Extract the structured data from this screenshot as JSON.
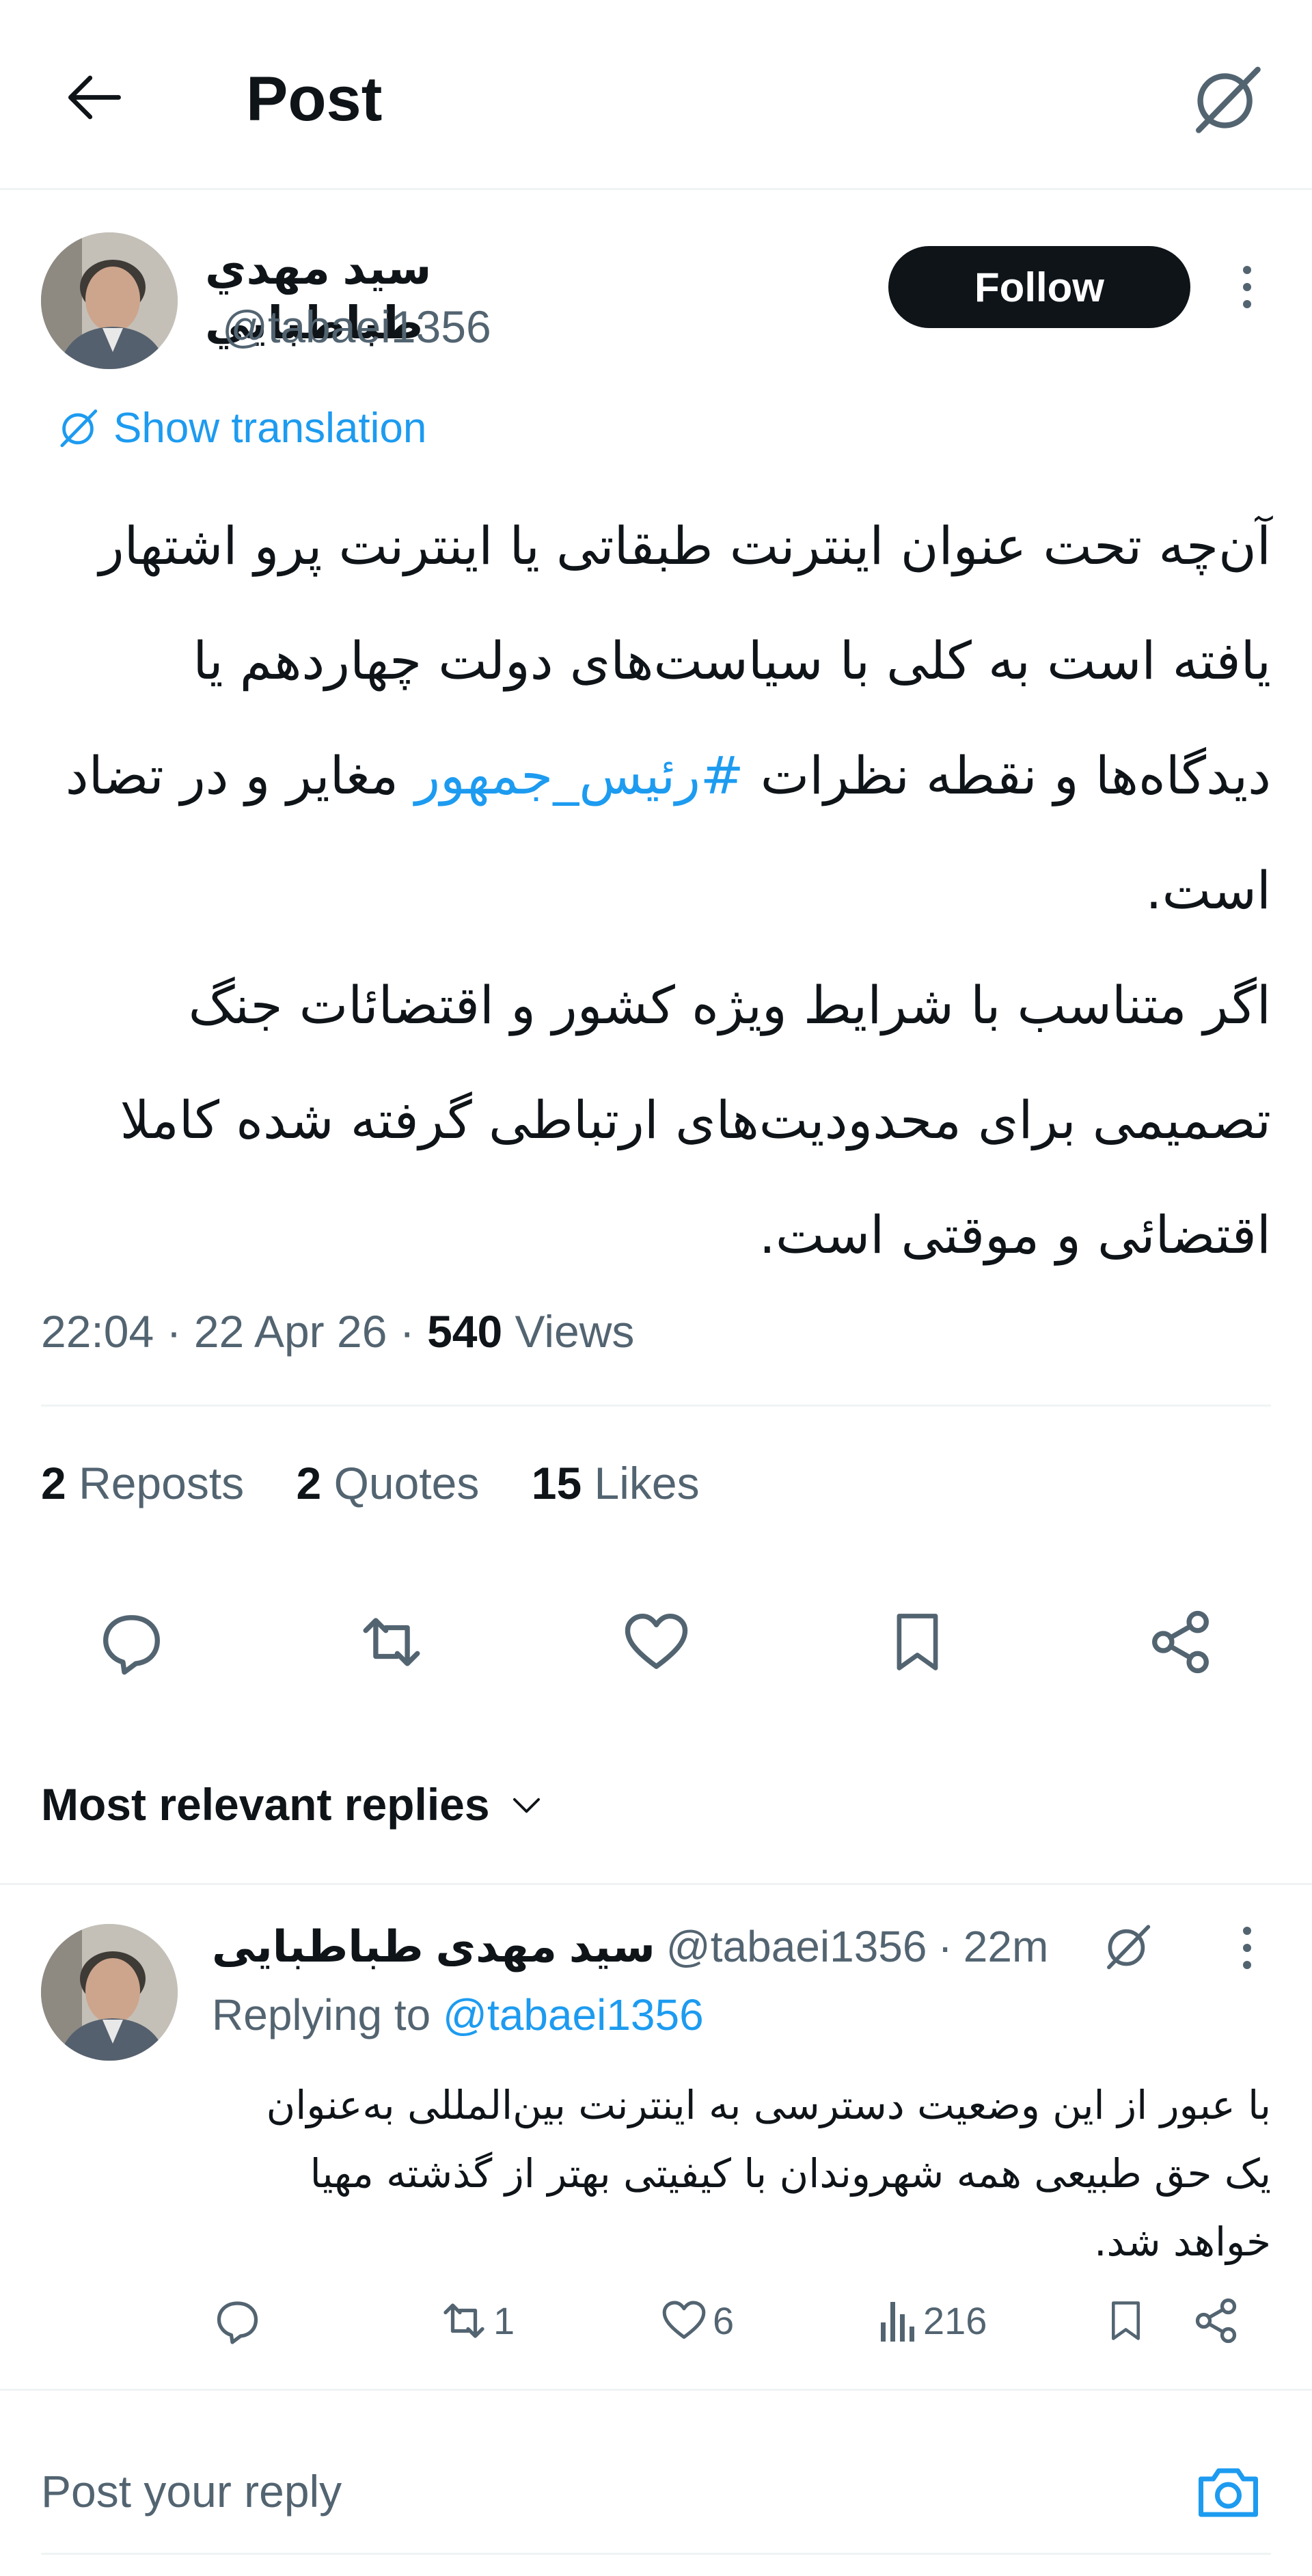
{
  "header": {
    "title": "Post"
  },
  "tweet": {
    "author_name": "سيد مهدي طباطبايي",
    "author_handle": "@tabaei1356",
    "follow_label": "Follow",
    "translate_label": "Show translation",
    "text_part1": "آن‌چه تحت عنوان اینترنت طبقاتی یا اینترنت پرو اشتهار یافته است به کلی با سیاست‌های دولت چهاردهم یا دیدگاه‌ها و نقطه نظرات ",
    "hashtag": "#رئیس_جمهور",
    "text_part2": " مغایر و در تضاد است.",
    "text_paragraph2": "اگر متناسب با شرایط ویژه کشور و اقتضائات جنگ تصمیمی برای محدودیت‌های ارتباطی گرفته شده کاملا اقتضائی و موقتی است.",
    "time": "22:04",
    "date": "22 Apr 26",
    "views_count": "540",
    "views_label": "Views",
    "reposts_count": "2",
    "reposts_label": "Reposts",
    "quotes_count": "2",
    "quotes_label": "Quotes",
    "likes_count": "15",
    "likes_label": "Likes"
  },
  "replies_section": {
    "sort_label": "Most relevant replies"
  },
  "reply": {
    "author_name": "سید مهدی طباطبایی",
    "handle": "@tabaei1356",
    "time": "22m",
    "replying_label": "Replying to",
    "replying_handle": "@tabaei1356",
    "text": "با عبور از این وضعیت دسترسی به اینترنت بین‌المللی به‌عنوان یک حق طبیعی همه شهروندان با کیفیتی بهتر از گذشته مهیا خواهد شد.",
    "retweets": "1",
    "likes": "6",
    "views": "216"
  },
  "composer": {
    "placeholder": "Post your reply"
  },
  "colors": {
    "accent": "#1d9bf0",
    "text": "#0f1419",
    "muted": "#536471",
    "follow_bg": "#0f1419"
  },
  "icons": [
    "back-arrow-icon",
    "grok-icon",
    "more-icon",
    "translate-icon",
    "reply-icon",
    "repost-icon",
    "like-icon",
    "bookmark-icon",
    "share-icon",
    "chevron-down-icon",
    "views-icon",
    "camera-icon"
  ]
}
